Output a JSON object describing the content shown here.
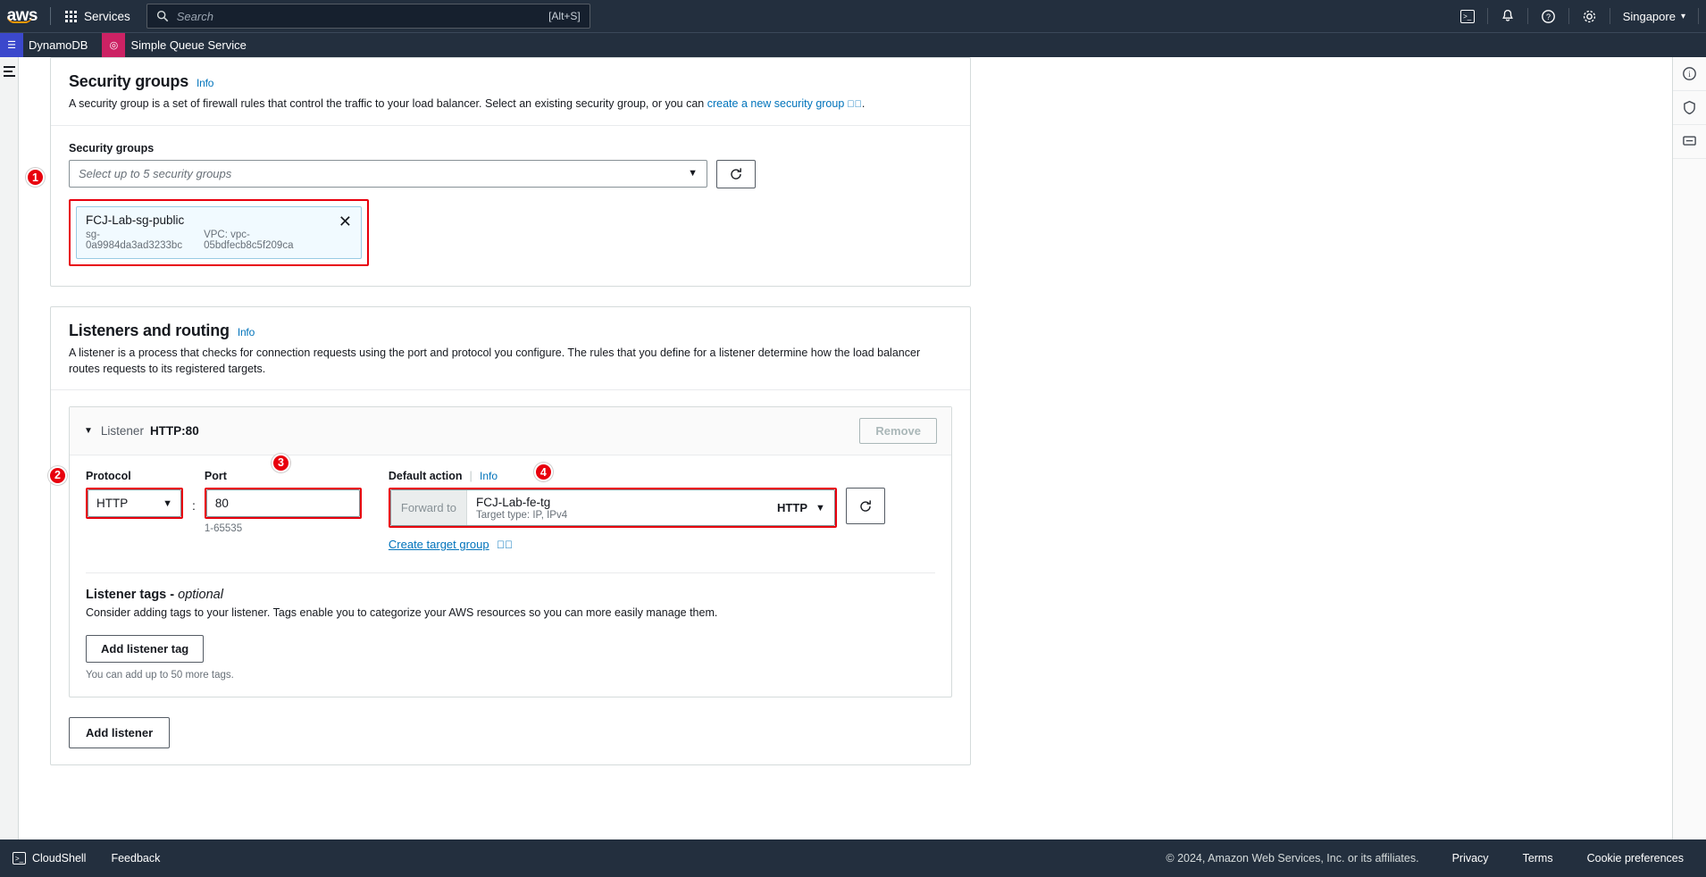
{
  "topnav": {
    "logo": "aws",
    "services_label": "Services",
    "search_placeholder": "Search",
    "search_shortcut": "[Alt+S]",
    "icons": [
      "cloudshell-icon",
      "notifications-icon",
      "help-icon",
      "settings-icon"
    ],
    "region": "Singapore",
    "region_caret": "▾"
  },
  "service_tabs": [
    {
      "label": "DynamoDB",
      "color": "#3b48cc",
      "glyph": "☰"
    },
    {
      "label": "Simple Queue Service",
      "color": "#cc2264",
      "glyph": "◎"
    }
  ],
  "security_groups": {
    "title": "Security groups",
    "info": "Info",
    "description_before": "A security group is a set of firewall rules that control the traffic to your load balancer. Select an existing security group, or you can ",
    "description_link": "create a new security group",
    "description_after": ".",
    "field_label": "Security groups",
    "select_placeholder": "Select up to 5 security groups",
    "select_caret": "▼",
    "refresh_icon": "refresh-icon",
    "selected_token": {
      "name": "FCJ-Lab-sg-public",
      "id": "sg-0a9984da3ad3233bc",
      "vpc": "VPC: vpc-05bdfecb8c5f209ca",
      "remove": "✕"
    }
  },
  "listeners": {
    "title": "Listeners and routing",
    "info": "Info",
    "description": "A listener is a process that checks for connection requests using the port and protocol you configure. The rules that you define for a listener determine how the load balancer routes requests to its registered targets.",
    "card": {
      "toggle": "▼",
      "label": "Listener",
      "value": "HTTP:80",
      "remove_label": "Remove",
      "protocol_label": "Protocol",
      "protocol_value": "HTTP",
      "protocol_caret": "▼",
      "colon": ":",
      "port_label": "Port",
      "port_value": "80",
      "port_hint": "1-65535",
      "default_action_label": "Default action",
      "default_action_info": "Info",
      "forward_prefix": "Forward to",
      "target_group_name": "FCJ-Lab-fe-tg",
      "target_group_sub": "Target type: IP, IPv4",
      "target_protocol": "HTTP",
      "target_caret": "▼",
      "target_refresh_icon": "refresh-icon",
      "create_target_group_link": "Create target group",
      "external_icon": "external-link-icon",
      "tags_title": "Listener tags - ",
      "tags_title_em": "optional",
      "tags_desc": "Consider adding tags to your listener. Tags enable you to categorize your AWS resources so you can more easily manage them.",
      "add_tag_button": "Add listener tag",
      "tags_hint": "You can add up to 50 more tags."
    },
    "add_listener_button": "Add listener"
  },
  "annotations": [
    {
      "number": "1"
    },
    {
      "number": "2"
    },
    {
      "number": "3"
    },
    {
      "number": "4"
    }
  ],
  "right_rail": [
    "info-icon",
    "shield-icon",
    "chat-icon"
  ],
  "footer": {
    "cloudshell": "CloudShell",
    "feedback": "Feedback",
    "copyright": "© 2024, Amazon Web Services, Inc. or its affiliates.",
    "privacy": "Privacy",
    "terms": "Terms",
    "cookies": "Cookie preferences"
  },
  "colors": {
    "nav_bg": "#232f3e",
    "link": "#0073bb",
    "annotation": "#e8000d",
    "token_bg": "#f1faff"
  }
}
